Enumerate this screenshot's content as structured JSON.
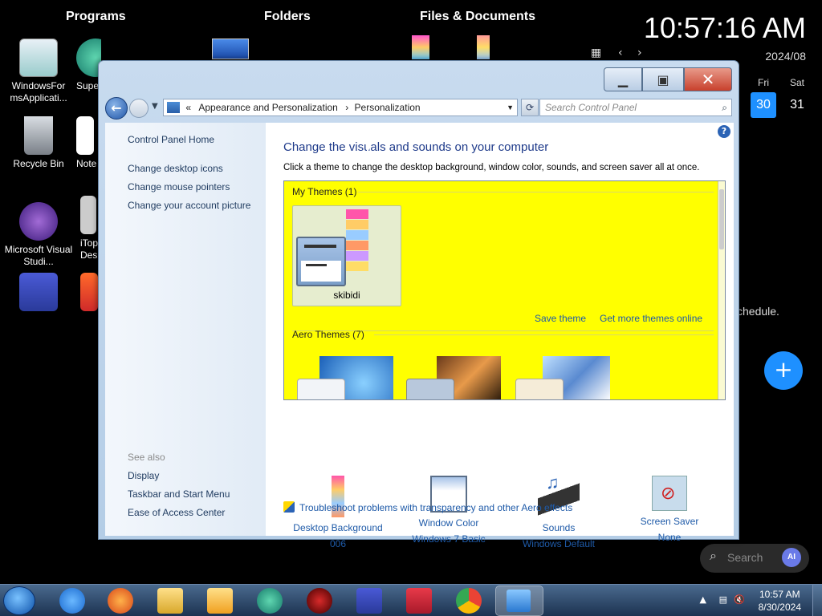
{
  "desktop": {
    "headers": [
      "Programs",
      "Folders",
      "Files & Documents"
    ],
    "icons": [
      {
        "label": "WindowsFor msApplicati..."
      },
      {
        "label": "Supe"
      },
      {
        "label": "Recycle Bin"
      },
      {
        "label": "Note"
      },
      {
        "label": "Microsoft Visual Studi..."
      },
      {
        "label": "iTop Desk"
      }
    ],
    "clock": {
      "time": "10:57:16 AM",
      "date": "2024/08"
    },
    "calendar": {
      "day_headers": [
        "Fri",
        "Sat"
      ],
      "days": [
        "30",
        "31"
      ],
      "selected": "30"
    },
    "schedule_text": "chedule.",
    "fab_label": "+",
    "search_label": "Search",
    "ai_badge": "AI"
  },
  "window": {
    "breadcrumb": [
      "«",
      "Appearance and Personalization",
      "Personalization"
    ],
    "search_placeholder": "Search Control Panel",
    "left_links": [
      "Control Panel Home",
      "Change desktop icons",
      "Change mouse pointers",
      "Change your account picture"
    ],
    "see_also_label": "See also",
    "see_also_links": [
      "Display",
      "Taskbar and Start Menu",
      "Ease of Access Center"
    ],
    "title": "Change the visuals and sounds on your computer",
    "subtitle": "Click a theme to change the desktop background, window color, sounds, and screen saver all at once.",
    "my_themes_label": "My Themes (1)",
    "my_theme_name": "skibidi",
    "save_theme": "Save theme",
    "get_more": "Get more themes online",
    "aero_label": "Aero Themes (7)",
    "bottom_items": [
      {
        "title": "Desktop Background",
        "value": "006"
      },
      {
        "title": "Window Color",
        "value": "Windows 7 Basic"
      },
      {
        "title": "Sounds",
        "value": "Windows Default"
      },
      {
        "title": "Screen Saver",
        "value": "None"
      }
    ],
    "troubleshoot": "Troubleshoot problems with transparency and other Aero effects",
    "theme_box_color": "#ffff00"
  },
  "taskbar": {
    "time": "10:57 AM",
    "date": "8/30/2024"
  }
}
